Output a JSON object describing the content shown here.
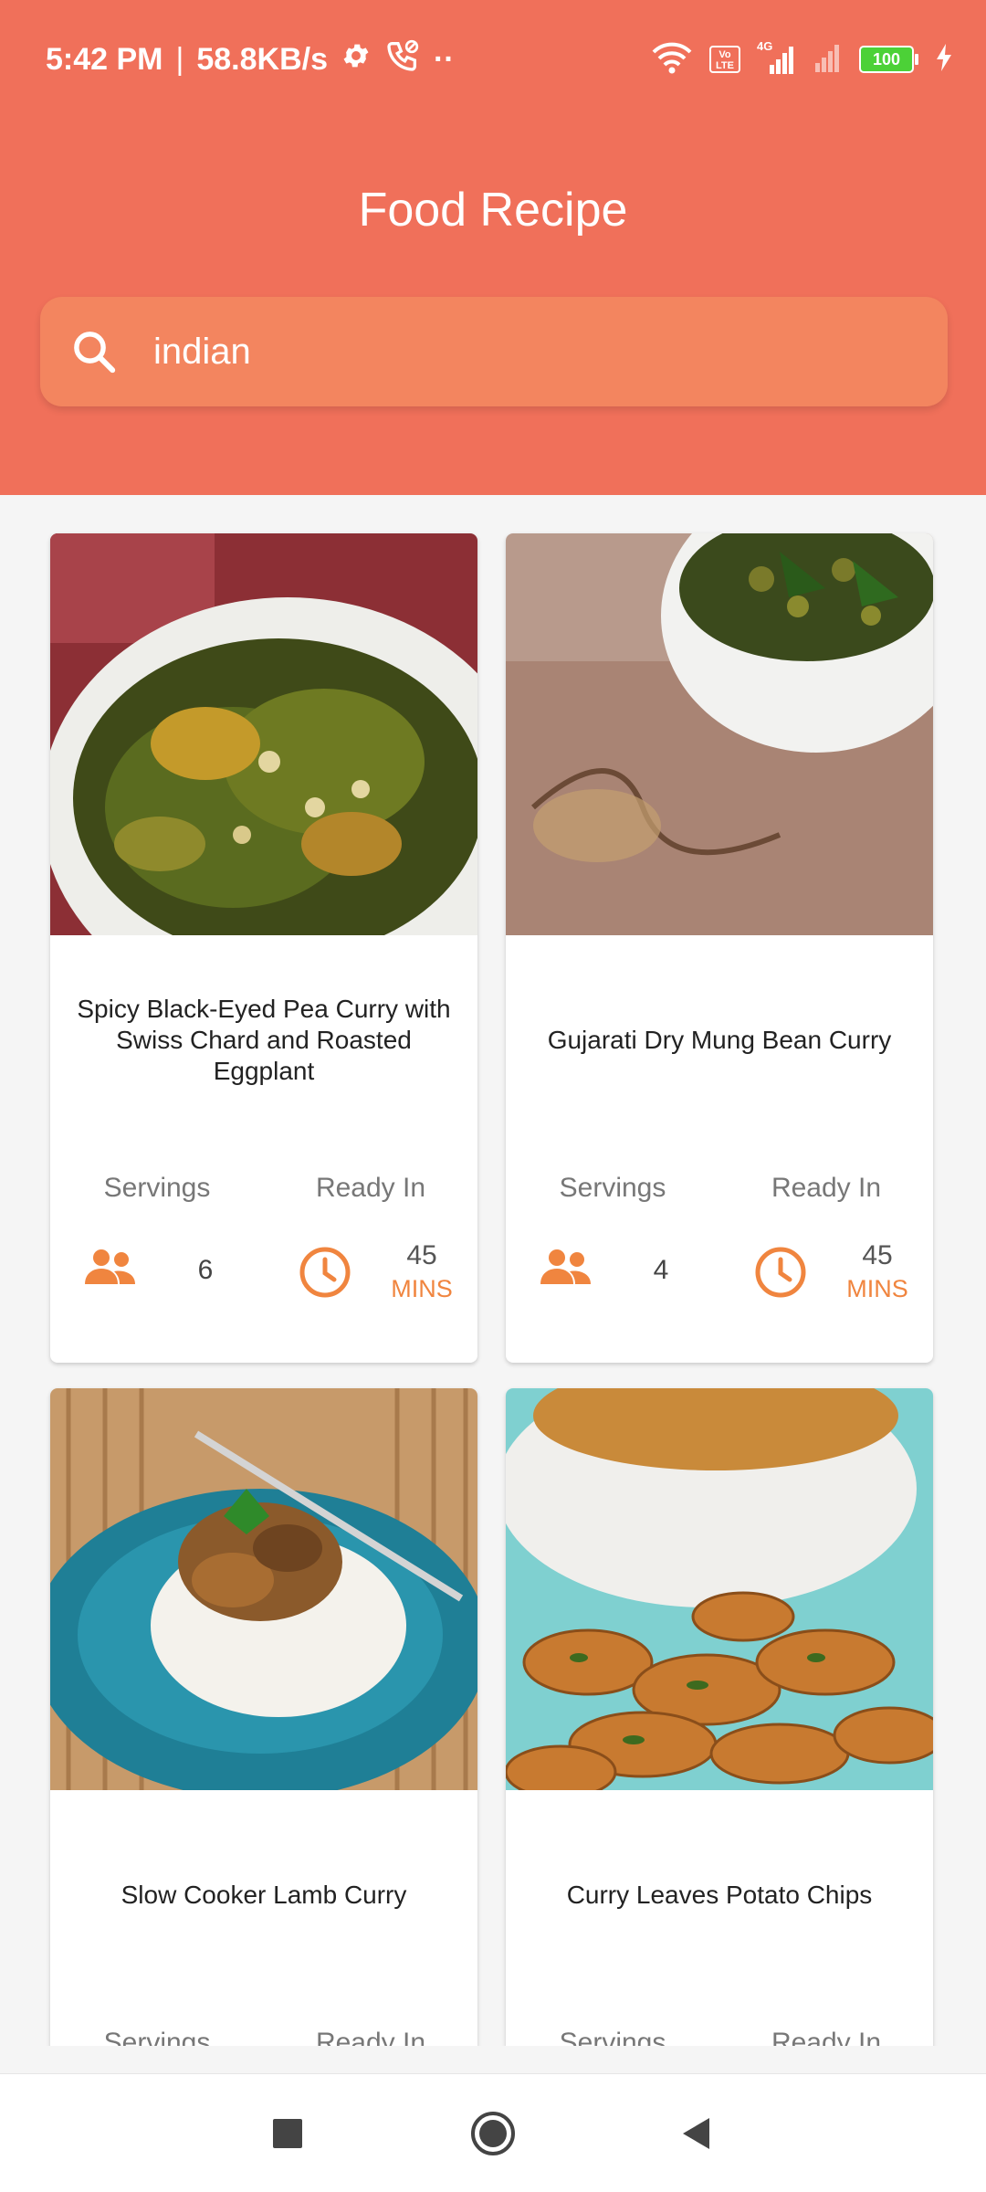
{
  "status_bar": {
    "time": "5:42 PM",
    "separator": "|",
    "speed": "58.8KB/s",
    "dots": "··",
    "volte": "Vo LTE",
    "network": "4G",
    "battery": "100"
  },
  "app": {
    "title": "Food Recipe"
  },
  "search": {
    "value": "indian",
    "icon": "search-icon"
  },
  "labels": {
    "servings": "Servings",
    "ready_in": "Ready In",
    "unit": "MINS"
  },
  "colors": {
    "header": "#f0705a",
    "search_bg": "#f3855f",
    "accent": "#f0853f",
    "background": "#f5f5f5"
  },
  "recipes": [
    {
      "title": "Spicy Black-Eyed Pea Curry with Swiss Chard and Roasted Eggplant",
      "servings": "6",
      "ready_in": "45"
    },
    {
      "title": "Gujarati Dry Mung Bean Curry",
      "servings": "4",
      "ready_in": "45"
    },
    {
      "title": "Slow Cooker Lamb Curry",
      "servings": "",
      "ready_in": ""
    },
    {
      "title": "Curry Leaves Potato Chips",
      "servings": "",
      "ready_in": ""
    }
  ],
  "nav": {
    "recents": "square-icon",
    "home": "circle-icon",
    "back": "triangle-back-icon"
  }
}
